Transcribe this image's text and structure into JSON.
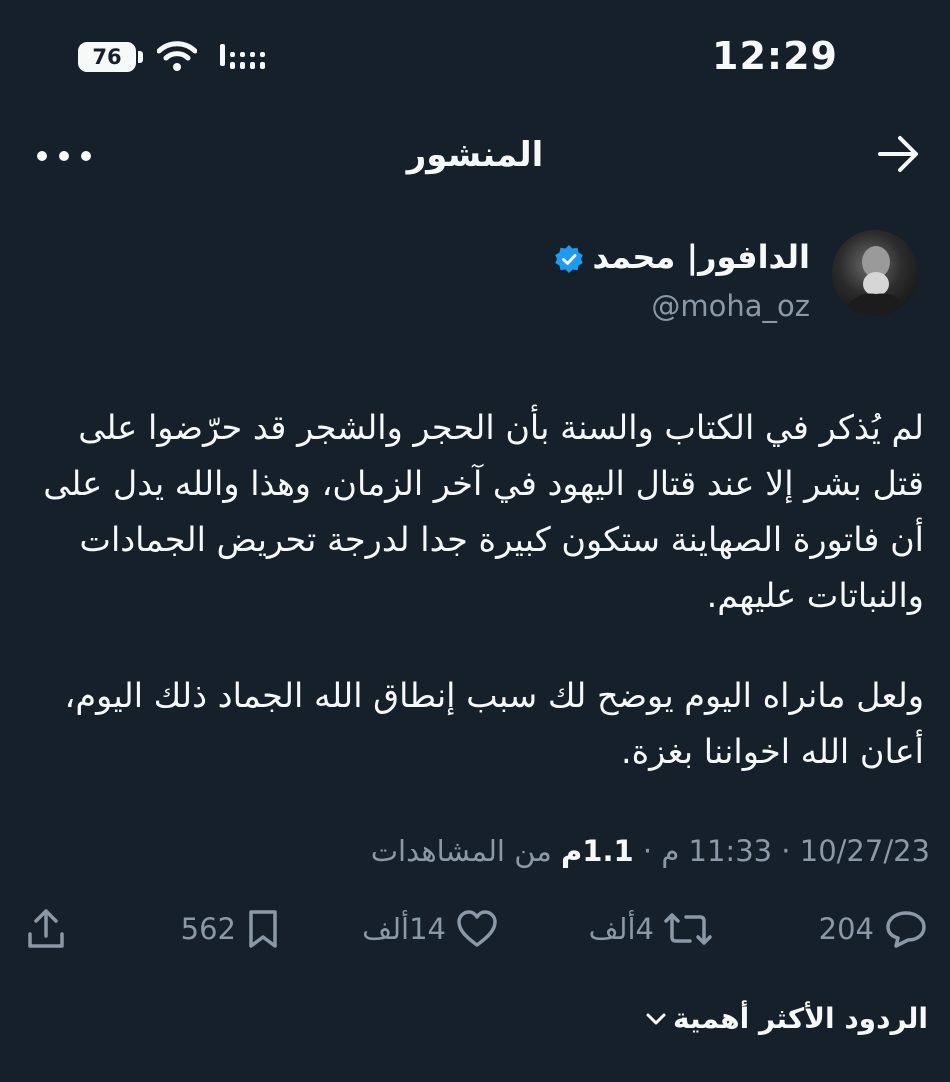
{
  "status_bar": {
    "time": "12:29",
    "battery": "76"
  },
  "header": {
    "title": "المنشور"
  },
  "author": {
    "name": "الدافور| محمد",
    "handle": "@moha_oz"
  },
  "tweet": {
    "paragraph1": "لم يُذكر في الكتاب والسنة بأن الحجر والشجر قد حرّضوا على قتل بشر إلا عند قتال اليهود في آخر الزمان، وهذا والله يدل على أن فاتورة الصهاينة ستكون كبيرة جدا لدرجة تحريض الجمادات والنباتات عليهم.",
    "paragraph2": "ولعل مانراه اليوم يوضح لك سبب إنطاق الله الجماد ذلك اليوم، أعان الله اخواننا بغزة."
  },
  "meta": {
    "date": "10/27/23",
    "time": "11:33 م",
    "views_count": "1.1م",
    "views_label": "من المشاهدات"
  },
  "actions": {
    "replies": "204",
    "retweets": "4ألف",
    "likes": "14ألف",
    "bookmarks": "562"
  },
  "replies_sort": {
    "label": "الردود الأكثر أهمية"
  },
  "icons": [
    "battery-icon",
    "wifi-icon",
    "signal-icon",
    "more-icon",
    "back-arrow-icon",
    "verified-badge-icon",
    "reply-icon",
    "retweet-icon",
    "like-icon",
    "bookmark-icon",
    "share-icon",
    "chevron-down-icon"
  ],
  "colors": {
    "background": "#15202b",
    "text": "#f7f9f9",
    "secondary": "#8b98a5",
    "verified": "#1d9bf0"
  }
}
